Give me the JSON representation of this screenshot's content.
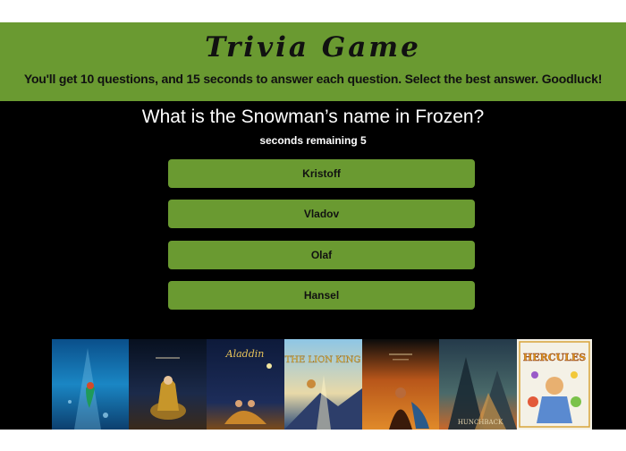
{
  "header": {
    "title": "Trivia Game",
    "instructions": "You'll get 10 questions, and 15 seconds to answer each question. Select the best answer. Goodluck!"
  },
  "quiz": {
    "question": "What is the Snowman’s name in Frozen?",
    "timer_text": "seconds remaining 5",
    "answers": [
      "Kristoff",
      "Vladov",
      "Olaf",
      "Hansel"
    ]
  },
  "posters": [
    {
      "name": "little-mermaid-poster",
      "palette": "blue"
    },
    {
      "name": "beauty-and-beast-poster",
      "palette": "dark-blue"
    },
    {
      "name": "aladdin-poster",
      "palette": "navy-gold",
      "lettering": "Aladdin"
    },
    {
      "name": "lion-king-poster",
      "palette": "sky-blue",
      "lettering": "THE LION KING"
    },
    {
      "name": "pocahontas-poster",
      "palette": "orange"
    },
    {
      "name": "hunchback-poster",
      "palette": "teal-orange",
      "lettering": "HUNCHBACK"
    },
    {
      "name": "hercules-poster",
      "palette": "white-multicolor",
      "lettering": "HERCULES"
    }
  ],
  "colors": {
    "accent_green": "#6a9a31",
    "background": "#000000"
  }
}
